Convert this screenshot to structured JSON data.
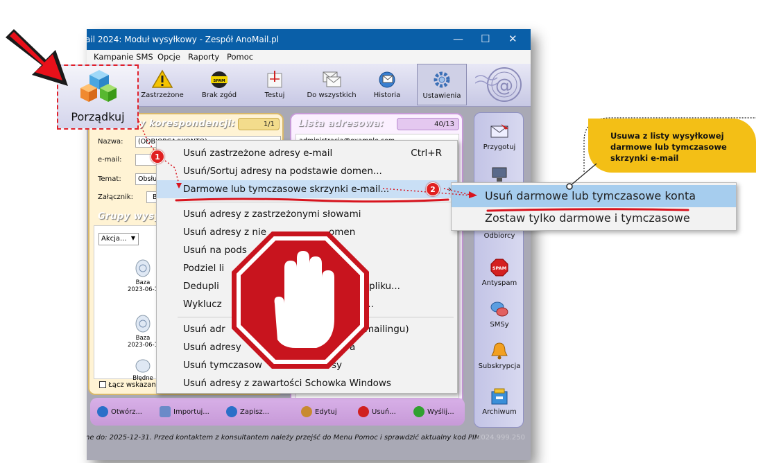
{
  "window": {
    "title": "ail 2024: Moduł wysyłkowy - Zespół AnoMail.pl",
    "minimize_glyph": "—",
    "maximize_glyph": "☐",
    "close_glyph": "✕"
  },
  "menubar": [
    "Kampanie SMS",
    "Opcje",
    "Raporty",
    "Pomoc"
  ],
  "toolbar": {
    "porzadkuj_label": "Porządkuj",
    "buttons": [
      "Zastrzeżone",
      "Brak zgód",
      "Testuj",
      "Do wszystkich",
      "Historia",
      "Ustawienia"
    ],
    "spam_badge": "SPAM BLOCK"
  },
  "left_panel": {
    "title": "y korespondencji:",
    "count": "1/1",
    "fields": {
      "nazwa_label": "Nazwa:",
      "nazwa_value": "(ODBIORCA#KONTO)",
      "email_label": "e-mail:",
      "temat_label": "Temat:",
      "temat_value": "Obsługa",
      "zalacznik_label": "Załącznik:",
      "zalacznik_value": "Br"
    },
    "groups_title": "Grupy wysył",
    "akcje_label": "Akcja...",
    "akcje_arrow": "▼",
    "groups": [
      {
        "name": "Baza",
        "date": "2023-06-1"
      },
      {
        "name": "Baza",
        "date": "2023-06-1"
      },
      {
        "name": "Błędne",
        "date": ""
      }
    ],
    "checkbox_label": "Łącz wskazane"
  },
  "right_panel": {
    "title": "Lista adresowa:",
    "count": "40/13",
    "first_row": "administracja@example.com"
  },
  "side_buttons": [
    "Przygotuj",
    "",
    "Odbiorcy",
    "Antyspam",
    "SMSy",
    "Subskrypcja",
    "Archiwum"
  ],
  "side_spam_text": "SPAM",
  "bottom_buttons": [
    "Otwórz...",
    "Importuj...",
    "Zapisz...",
    "Edytuj",
    "Usuń...",
    "Wyślij..."
  ],
  "status": {
    "text": "ne do: 2025-12-31. Przed kontaktem z konsultantem należy przejść do Menu Pomoc i sprawdzić aktualny kod PIN",
    "version": "2024.999.250"
  },
  "context_menu": {
    "items": [
      {
        "label": "Usuń zastrzeżone adresy e-mail",
        "shortcut": "Ctrl+R"
      },
      {
        "label": "Usuń/Sortuj adresy na podstawie domen...",
        "shortcut": ""
      },
      {
        "label": "Darmowe lub tymczasowe skrzynki e-mail...",
        "shortcut": "",
        "highlighted": true,
        "submenu_arrow": "›"
      },
      {
        "label": "Usuń adresy z zastrzeżonymi słowami",
        "shortcut": ""
      },
      {
        "label": "Usuń adresy z nie",
        "suffix": "omen",
        "shortcut": ""
      },
      {
        "label": "Usuń na pods",
        "shortcut": ""
      },
      {
        "label": "Podziel li",
        "shortcut": ""
      },
      {
        "label": "Dedupli",
        "suffix": "pliku...",
        "shortcut": ""
      },
      {
        "label": "Wyklucz",
        "suffix": "...",
        "shortcut": ""
      },
      {
        "label": "Usuń adr",
        "suffix": "mailingu)",
        "shortcut": ""
      },
      {
        "label": "Usuń adresy",
        "suffix": "a",
        "shortcut": ""
      },
      {
        "label": "Usuń tymczasow",
        "suffix": "sy",
        "shortcut": ""
      },
      {
        "label": "Usuń adresy z zawartości Schowka Windows",
        "shortcut": ""
      }
    ]
  },
  "submenu": {
    "items": [
      "Usuń darmowe lub tymczasowe konta",
      "Zostaw tylko darmowe i tymczasowe"
    ]
  },
  "callout": {
    "lines": [
      "Usuwa z listy wysyłkowej",
      "darmowe lub tymczasowe",
      "skrzynki e-mail"
    ]
  },
  "badges": [
    "1",
    "2"
  ],
  "colors": {
    "titlebar": "#0a5fa8",
    "callout": "#f3bf16",
    "stop_sign": "#c8141e",
    "arrow": "#e8101a",
    "highlight": "#a6cdee"
  }
}
